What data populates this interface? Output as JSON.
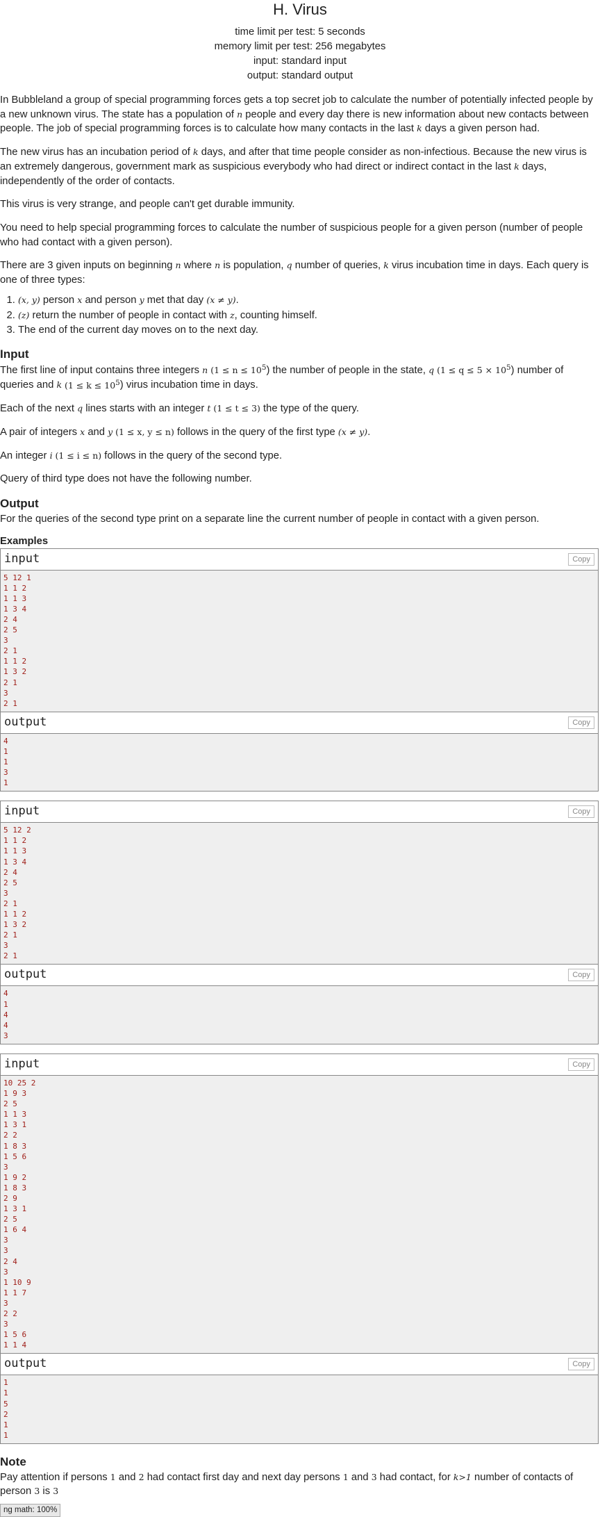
{
  "header": {
    "title": "H. Virus",
    "time_limit": "time limit per test: 5 seconds",
    "memory_limit": "memory limit per test: 256 megabytes",
    "input": "input: standard input",
    "output": "output: standard output"
  },
  "statement": {
    "p1a": "In Bubbleland a group of special programming forces gets a top secret job to calculate the number of potentially infected people by a new unknown virus. The state has a population of ",
    "p1b": " people and every day there is new information about new contacts between people. The job of special programming forces is to calculate how many contacts in the last ",
    "p1c": " days a given person had.",
    "p2a": "The new virus has an incubation period of ",
    "p2b": " days, and after that time people consider as non-infectious. Because the new virus is an extremely dangerous, government mark as suspicious everybody who had direct or indirect contact in the last ",
    "p2c": " days, independently of the order of contacts.",
    "p3": "This virus is very strange, and people can't get durable immunity.",
    "p4": "You need to help special programming forces to calculate the number of suspicious people for a given person (number of people who had contact with a given person).",
    "p5a": "There are 3 given inputs on beginning ",
    "p5b": " where ",
    "p5c": " is population, ",
    "p5d": " number of queries, ",
    "p5e": " virus incubation time in days. Each query is one of three types:",
    "li1a": "(x, y)",
    "li1b": " person ",
    "li1c": " and person ",
    "li1d": " met that day ",
    "li1e": "(x ≠ y)",
    "li1f": ".",
    "li2a": "(z)",
    "li2b": " return the number of people in contact with ",
    "li2c": ", counting himself.",
    "li3": "The end of the current day moves on to the next day."
  },
  "math": {
    "n": "n",
    "k": "k",
    "q": "q",
    "x": "x",
    "y": "y",
    "z": "z",
    "t": "t",
    "i": "i"
  },
  "input_section": {
    "title": "Input",
    "l1a": "The first line of input contains three integers ",
    "l1b": " (1 ≤ n ≤ 10",
    "l1b_sup": "5",
    "l1c": ") the number of people in the state, ",
    "l1d": " (1 ≤ q ≤ 5 × 10",
    "l1d_sup": "5",
    "l1e": ") number of queries and ",
    "l1f": " (1 ≤ k ≤ 10",
    "l1f_sup": "5",
    "l1g": ") virus incubation time in days.",
    "l2a": "Each of the next ",
    "l2b": " lines starts with an integer ",
    "l2c": " (1 ≤ t ≤ 3)",
    "l2d": " the type of the query.",
    "l3a": "A pair of integers ",
    "l3b": " and ",
    "l3c": " (1 ≤ x, y ≤ n)",
    "l3d": " follows in the query of the first type ",
    "l3e": "(x ≠ y)",
    "l3f": ".",
    "l4a": "An integer ",
    "l4b": " (1 ≤ i ≤ n)",
    "l4c": " follows in the query of the second type.",
    "l5": "Query of third type does not have the following number."
  },
  "output_section": {
    "title": "Output",
    "text": "For the queries of the second type print on a separate line the current number of people in contact with a given person."
  },
  "examples": {
    "title": "Examples",
    "input_label": "input",
    "output_label": "output",
    "copy_label": "Copy",
    "list": [
      {
        "input": [
          "5 12 1",
          "1 1 2",
          "1 1 3",
          "1 3 4",
          "2 4",
          "2 5",
          "3",
          "2 1",
          "1 1 2",
          "1 3 2",
          "2 1",
          "3",
          "2 1"
        ],
        "output": [
          "4",
          "1",
          "1",
          "3",
          "1"
        ]
      },
      {
        "input": [
          "5 12 2",
          "1 1 2",
          "1 1 3",
          "1 3 4",
          "2 4",
          "2 5",
          "3",
          "2 1",
          "1 1 2",
          "1 3 2",
          "2 1",
          "3",
          "2 1"
        ],
        "output": [
          "4",
          "1",
          "4",
          "4",
          "3"
        ]
      },
      {
        "input": [
          "10 25 2",
          "1 9 3",
          "2 5",
          "1 1 3",
          "1 3 1",
          "2 2",
          "1 8 3",
          "1 5 6",
          "3",
          "1 9 2",
          "1 8 3",
          "2 9",
          "1 3 1",
          "2 5",
          "1 6 4",
          "3",
          "3",
          "2 4",
          "3",
          "1 10 9",
          "1 1 7",
          "3",
          "2 2",
          "3",
          "1 5 6",
          "1 1 4"
        ],
        "output": [
          "1",
          "1",
          "5",
          "2",
          "1",
          "1"
        ]
      }
    ]
  },
  "note": {
    "title": "Note",
    "a": "Pay attention if persons ",
    "b": "1",
    "c": " and ",
    "d": "2",
    "e": " had contact first day and next day persons ",
    "f": "1",
    "g": " and ",
    "h": "3",
    "i": " had contact, for ",
    "j": "k>1",
    "k": " number of contacts of person ",
    "l": "3",
    "m": " is ",
    "n": "3"
  },
  "zoom_badge": "ng math: 100%"
}
